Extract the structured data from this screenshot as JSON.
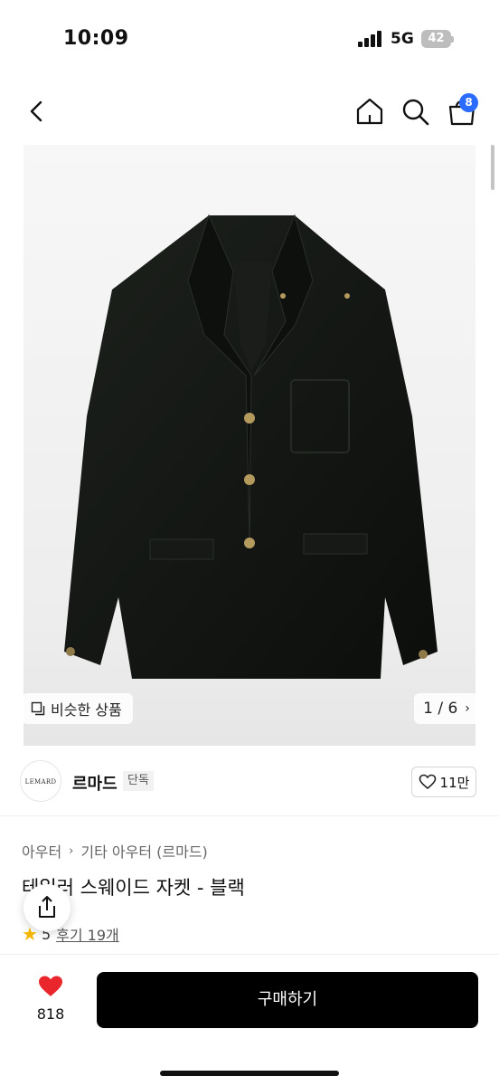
{
  "status_bar": {
    "time": "10:09",
    "network": "5G",
    "battery": "42"
  },
  "nav": {
    "cart_count": "8"
  },
  "gallery": {
    "similar_label": "비슷한 상품",
    "pager": "1 / 6"
  },
  "brand": {
    "logo_text": "LEMARD",
    "name": "르마드",
    "badge": "단독",
    "likes": "11만"
  },
  "category": {
    "level1": "아우터",
    "level2": "기타 아우터 (르마드)"
  },
  "product": {
    "title": "테일러 스웨이드 자켓 - 블랙",
    "rating": "5",
    "reviews": "후기 19개"
  },
  "bottom": {
    "wish_count": "818",
    "buy_label": "구매하기"
  },
  "colors": {
    "accent_badge": "#2b6bff",
    "heart": "#e8262b",
    "star": "#f5b800",
    "buy_button": "#000000"
  }
}
